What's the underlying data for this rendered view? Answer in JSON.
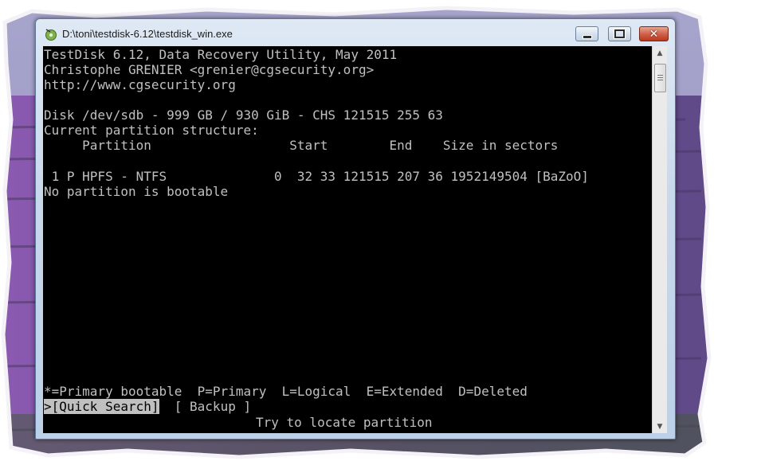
{
  "window": {
    "title": "D:\\toni\\testdisk-6.12\\testdisk_win.exe",
    "icon": "testdisk-app-icon",
    "controls": {
      "minimize": "minimize-icon",
      "maximize": "maximize-icon",
      "close": "close-icon"
    }
  },
  "console": {
    "header": {
      "line1": "TestDisk 6.12, Data Recovery Utility, May 2011",
      "line2": "Christophe GRENIER <grenier@cgsecurity.org>",
      "line3": "http://www.cgsecurity.org"
    },
    "disk_info": "Disk /dev/sdb - 999 GB / 930 GiB - CHS 121515 255 63",
    "structure_title": "Current partition structure:",
    "table_header": "     Partition                  Start        End    Size in sectors",
    "partition_row": " 1 P HPFS - NTFS              0  32 33 121515 207 36 1952149504 [BaZoO]",
    "boot_status": "No partition is bootable",
    "legend": "*=Primary bootable  P=Primary  L=Logical  E=Extended  D=Deleted",
    "menu": {
      "quick_search": ">[Quick Search]",
      "backup": "[ Backup ]"
    },
    "hint": "Try to locate partition"
  },
  "colors": {
    "console_bg": "#000000",
    "console_fg": "#c0c0c0",
    "lavender": "#7a5a9e"
  }
}
